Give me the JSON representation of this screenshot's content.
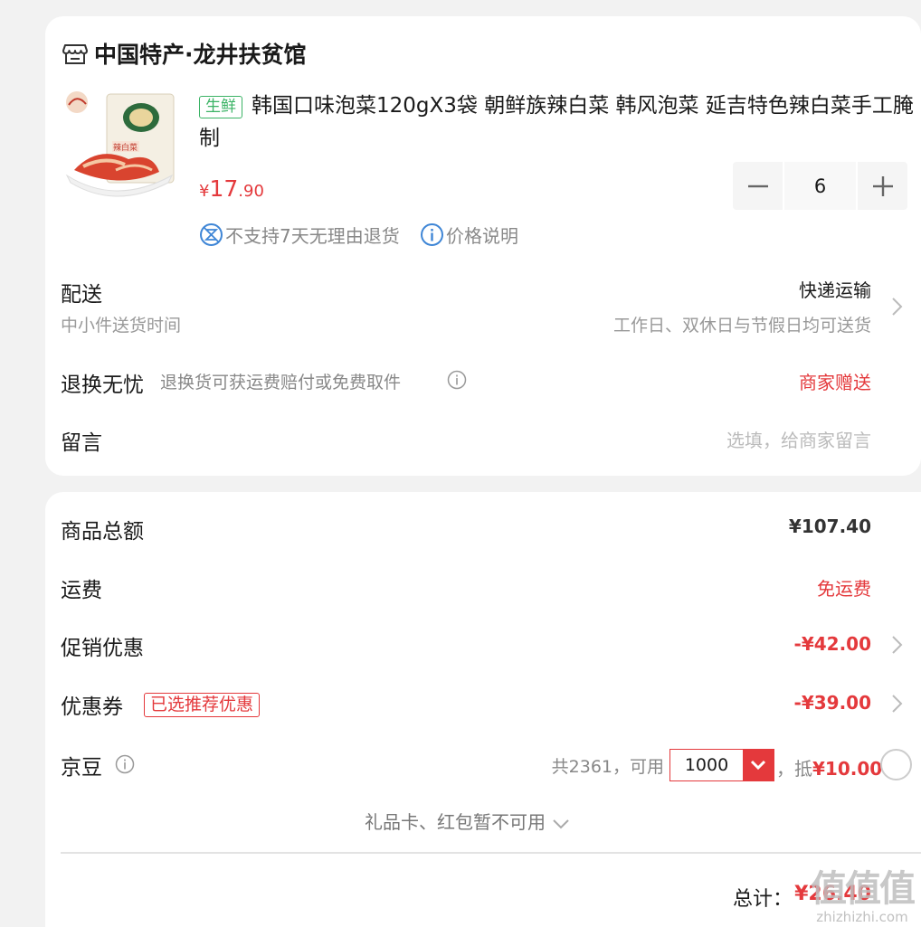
{
  "shop": {
    "name": "中国特产·龙井扶贫馆",
    "icon": "store-icon"
  },
  "product": {
    "tag": "生鲜",
    "title": "韩国口味泡菜120gX3袋 朝鲜族辣白菜 韩风泡菜 延吉特色辣白菜手工腌制",
    "price_currency": "¥",
    "price_int": "17",
    "price_dec": ".90",
    "quantity": "6",
    "service_no_return": "不支持7天无理由退货",
    "service_price_info": "价格说明",
    "package_text": "辣白菜"
  },
  "delivery": {
    "label": "配送",
    "sub": "中小件送货时间",
    "method": "快递运输",
    "schedule": "工作日、双休日与节假日均可送货"
  },
  "return": {
    "label": "退换无忧",
    "desc": "退换货可获运费赔付或免费取件",
    "value": "商家赠送"
  },
  "message": {
    "label": "留言",
    "placeholder": "选填，给商家留言"
  },
  "summary": {
    "goods_total_label": "商品总额",
    "goods_total": "¥107.40",
    "shipping_label": "运费",
    "shipping_value": "免运费",
    "promo_label": "促销优惠",
    "promo_value": "-¥42.00",
    "coupon_label": "优惠券",
    "coupon_tag": "已选推荐优惠",
    "coupon_value": "-¥39.00",
    "jd_label": "京豆",
    "jd_total": "共2361，可用",
    "jd_used": "1000",
    "jd_deduct_prefix": "，抵",
    "jd_deduct": "¥10.00",
    "giftcard_text": "礼品卡、红包暂不可用",
    "total_label": "总计：",
    "total_value": "¥26.40"
  },
  "watermark": {
    "logo": "值值值",
    "url": "zhizhizhi.com"
  },
  "colors": {
    "accent_red": "#e4393c",
    "fresh_green": "#3bb365",
    "page_bg": "#f2f2f2"
  }
}
